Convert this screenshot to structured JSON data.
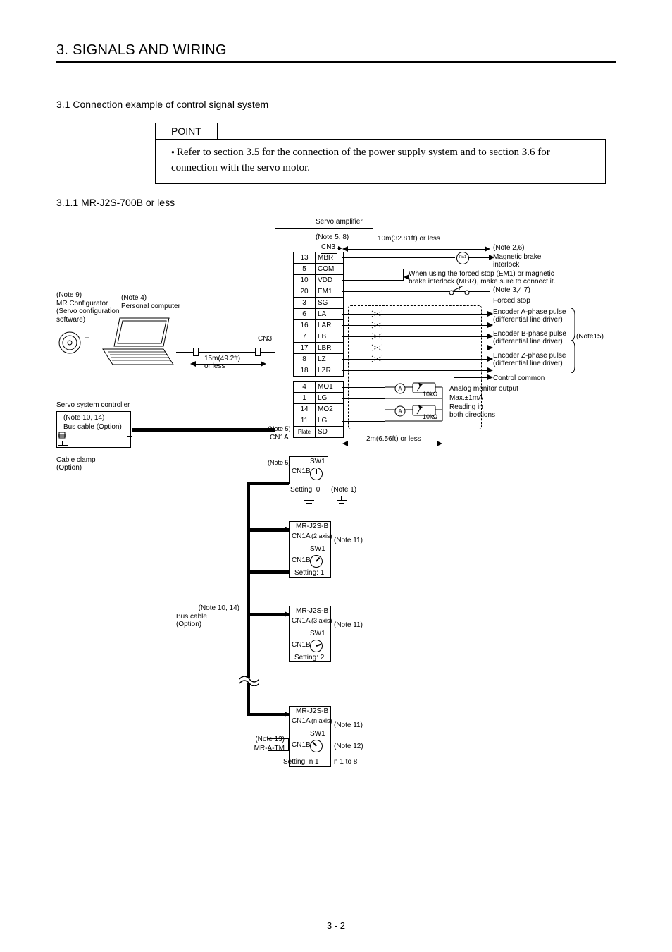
{
  "chapter": "3. SIGNALS AND WIRING",
  "section_3_1": "3.1 Connection example of control signal system",
  "point_label": "POINT",
  "point_text": "Refer to section 3.5 for the connection of the power supply system and to section 3.6 for connection with the servo motor.",
  "section_3_1_1": "3.1.1 MR-J2S-700B or less",
  "page_number": "3 - 2",
  "labels": {
    "servo_amp": "Servo amplifier",
    "note58": "(Note 5, 8)",
    "cn3_top": "CN3",
    "len10m": "10m(32.81ft) or less",
    "note26": "(Note 2,6)",
    "magbrake": "Magnetic brake\ninterlock",
    "forced_note": "When using the forced stop (EM1) or magnetic brake interlock (MBR), make sure to connect it.",
    "note347": "(Note 3,4,7)",
    "forced_stop": "Forced stop",
    "note9": "(Note 9)",
    "mrconf": "MR Configurator\n(Servo configuration\nsoftware)",
    "note4": "(Note 4)",
    "pc": "Personal computer",
    "cn3_side": "CN3",
    "len15m": "15m(49.2ft)\nor less",
    "encA": "Encoder A-phase pulse\n(differential line driver)",
    "encB": "Encoder B-phase pulse\n(differential line driver)",
    "encZ": "Encoder Z-phase pulse\n(differential line driver)",
    "note15": "(Note15)",
    "ctrl_common": "Control common",
    "analog_mon": "Analog monitor output",
    "max1ma": "Max.±1mA",
    "reading": "Reading in\nboth directions",
    "tenk": "10kΩ",
    "note5_left": "(Note 5)",
    "cn1a_top": "CN1A",
    "plate": "Plate",
    "len2m": "2m(6.56ft) or less",
    "servo_ctrl": "Servo system controller",
    "note1014": "(Note 10, 14)",
    "bus_cable": "Bus cable (Option)",
    "cable_clamp": "Cable clamp\n(Option)",
    "note5b": "(Note 5)",
    "cn1b": "CN1B",
    "sw1": "SW1",
    "setting0": "Setting: 0",
    "note1": "(Note 1)",
    "amp2": "MR-J2S-B",
    "cn1a2": "CN1A",
    "ax2": "(2 axis)",
    "note11": "(Note 11)",
    "setting1": "Setting: 1",
    "amp3": "MR-J2S-B",
    "cn1a3": "CN1A",
    "ax3": "(3 axis)",
    "setting2": "Setting: 2",
    "note1014b": "(Note 10, 14)",
    "bus_cable2": "Bus cable\n(Option)",
    "ampn": "MR-J2S-B",
    "cn1an": "CN1A",
    "axn": "(n axis)",
    "note13": "(Note 13)",
    "mratm": "MR-A-TM",
    "settingn": "Setting: n  1",
    "note12": "(Note 12)",
    "n18": "n  1 to 8"
  },
  "cn3_pins": [
    {
      "pin": "13",
      "name": "MBR"
    },
    {
      "pin": "5",
      "name": "COM"
    },
    {
      "pin": "10",
      "name": "VDD"
    },
    {
      "pin": "20",
      "name": "EM1"
    },
    {
      "pin": "3",
      "name": "SG"
    },
    {
      "pin": "6",
      "name": "LA"
    },
    {
      "pin": "16",
      "name": "LAR"
    },
    {
      "pin": "7",
      "name": "LB"
    },
    {
      "pin": "17",
      "name": "LBR"
    },
    {
      "pin": "8",
      "name": "LZ"
    },
    {
      "pin": "18",
      "name": "LZR"
    },
    {
      "pin": "4",
      "name": "MO1"
    },
    {
      "pin": "1",
      "name": "LG"
    },
    {
      "pin": "14",
      "name": "MO2"
    },
    {
      "pin": "11",
      "name": "LG"
    },
    {
      "pin": "",
      "name": "SD"
    }
  ]
}
